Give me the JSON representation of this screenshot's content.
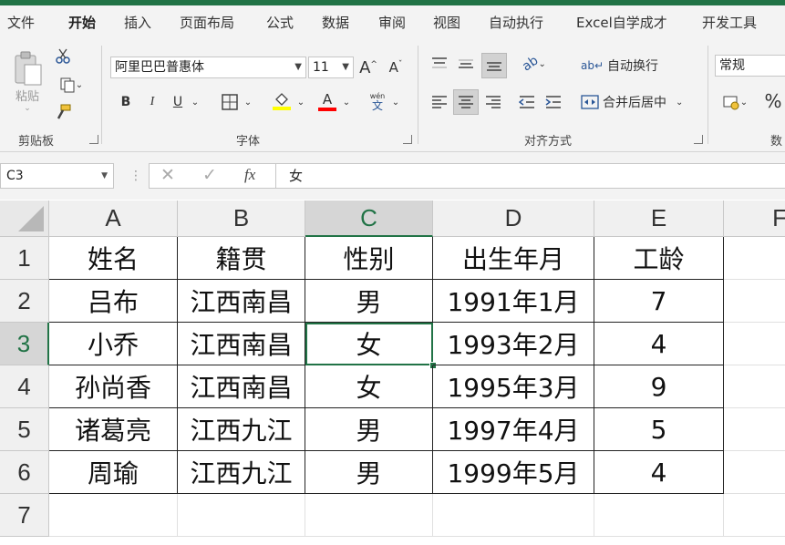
{
  "menu": {
    "tabs": [
      {
        "label": "文件",
        "active": false
      },
      {
        "label": "开始",
        "active": true
      },
      {
        "label": "插入",
        "active": false
      },
      {
        "label": "页面布局",
        "active": false
      },
      {
        "label": "公式",
        "active": false
      },
      {
        "label": "数据",
        "active": false
      },
      {
        "label": "审阅",
        "active": false
      },
      {
        "label": "视图",
        "active": false
      },
      {
        "label": "自动执行",
        "active": false
      },
      {
        "label": "Excel自学成才",
        "active": false
      },
      {
        "label": "开发工具",
        "active": false
      }
    ]
  },
  "ribbon": {
    "clipboard": {
      "paste_label": "粘贴",
      "group_label": "剪贴板"
    },
    "font": {
      "font_name": "阿里巴巴普惠体",
      "font_size": "11",
      "group_label": "字体",
      "bold": "B",
      "italic": "I",
      "underline": "U",
      "font_color": "A",
      "wen_top": "wén",
      "wen_bottom": "文"
    },
    "alignment": {
      "wrap_label": "自动换行",
      "merge_label": "合并后居中",
      "group_label": "对齐方式"
    },
    "number": {
      "format": "常规",
      "group_label": "数",
      "percent": "%"
    }
  },
  "formula_bar": {
    "cell_ref": "C3",
    "content": "女"
  },
  "colors": {
    "accent": "#217346",
    "selected_header": "#d6d6d6"
  },
  "grid": {
    "columns": [
      "A",
      "B",
      "C",
      "D",
      "E",
      "F"
    ],
    "selected_column": "C",
    "selected_row": "3",
    "rows": [
      {
        "num": "1",
        "cells": [
          "姓名",
          "籍贯",
          "性别",
          "出生年月",
          "工龄"
        ]
      },
      {
        "num": "2",
        "cells": [
          "吕布",
          "江西南昌",
          "男",
          "1991年1月",
          "7"
        ]
      },
      {
        "num": "3",
        "cells": [
          "小乔",
          "江西南昌",
          "女",
          "1993年2月",
          "4"
        ]
      },
      {
        "num": "4",
        "cells": [
          "孙尚香",
          "江西南昌",
          "女",
          "1995年3月",
          "9"
        ]
      },
      {
        "num": "5",
        "cells": [
          "诸葛亮",
          "江西九江",
          "男",
          "1997年4月",
          "5"
        ]
      },
      {
        "num": "6",
        "cells": [
          "周瑜",
          "江西九江",
          "男",
          "1999年5月",
          "4"
        ]
      },
      {
        "num": "7",
        "cells": [
          "",
          "",
          "",
          "",
          ""
        ]
      }
    ]
  }
}
